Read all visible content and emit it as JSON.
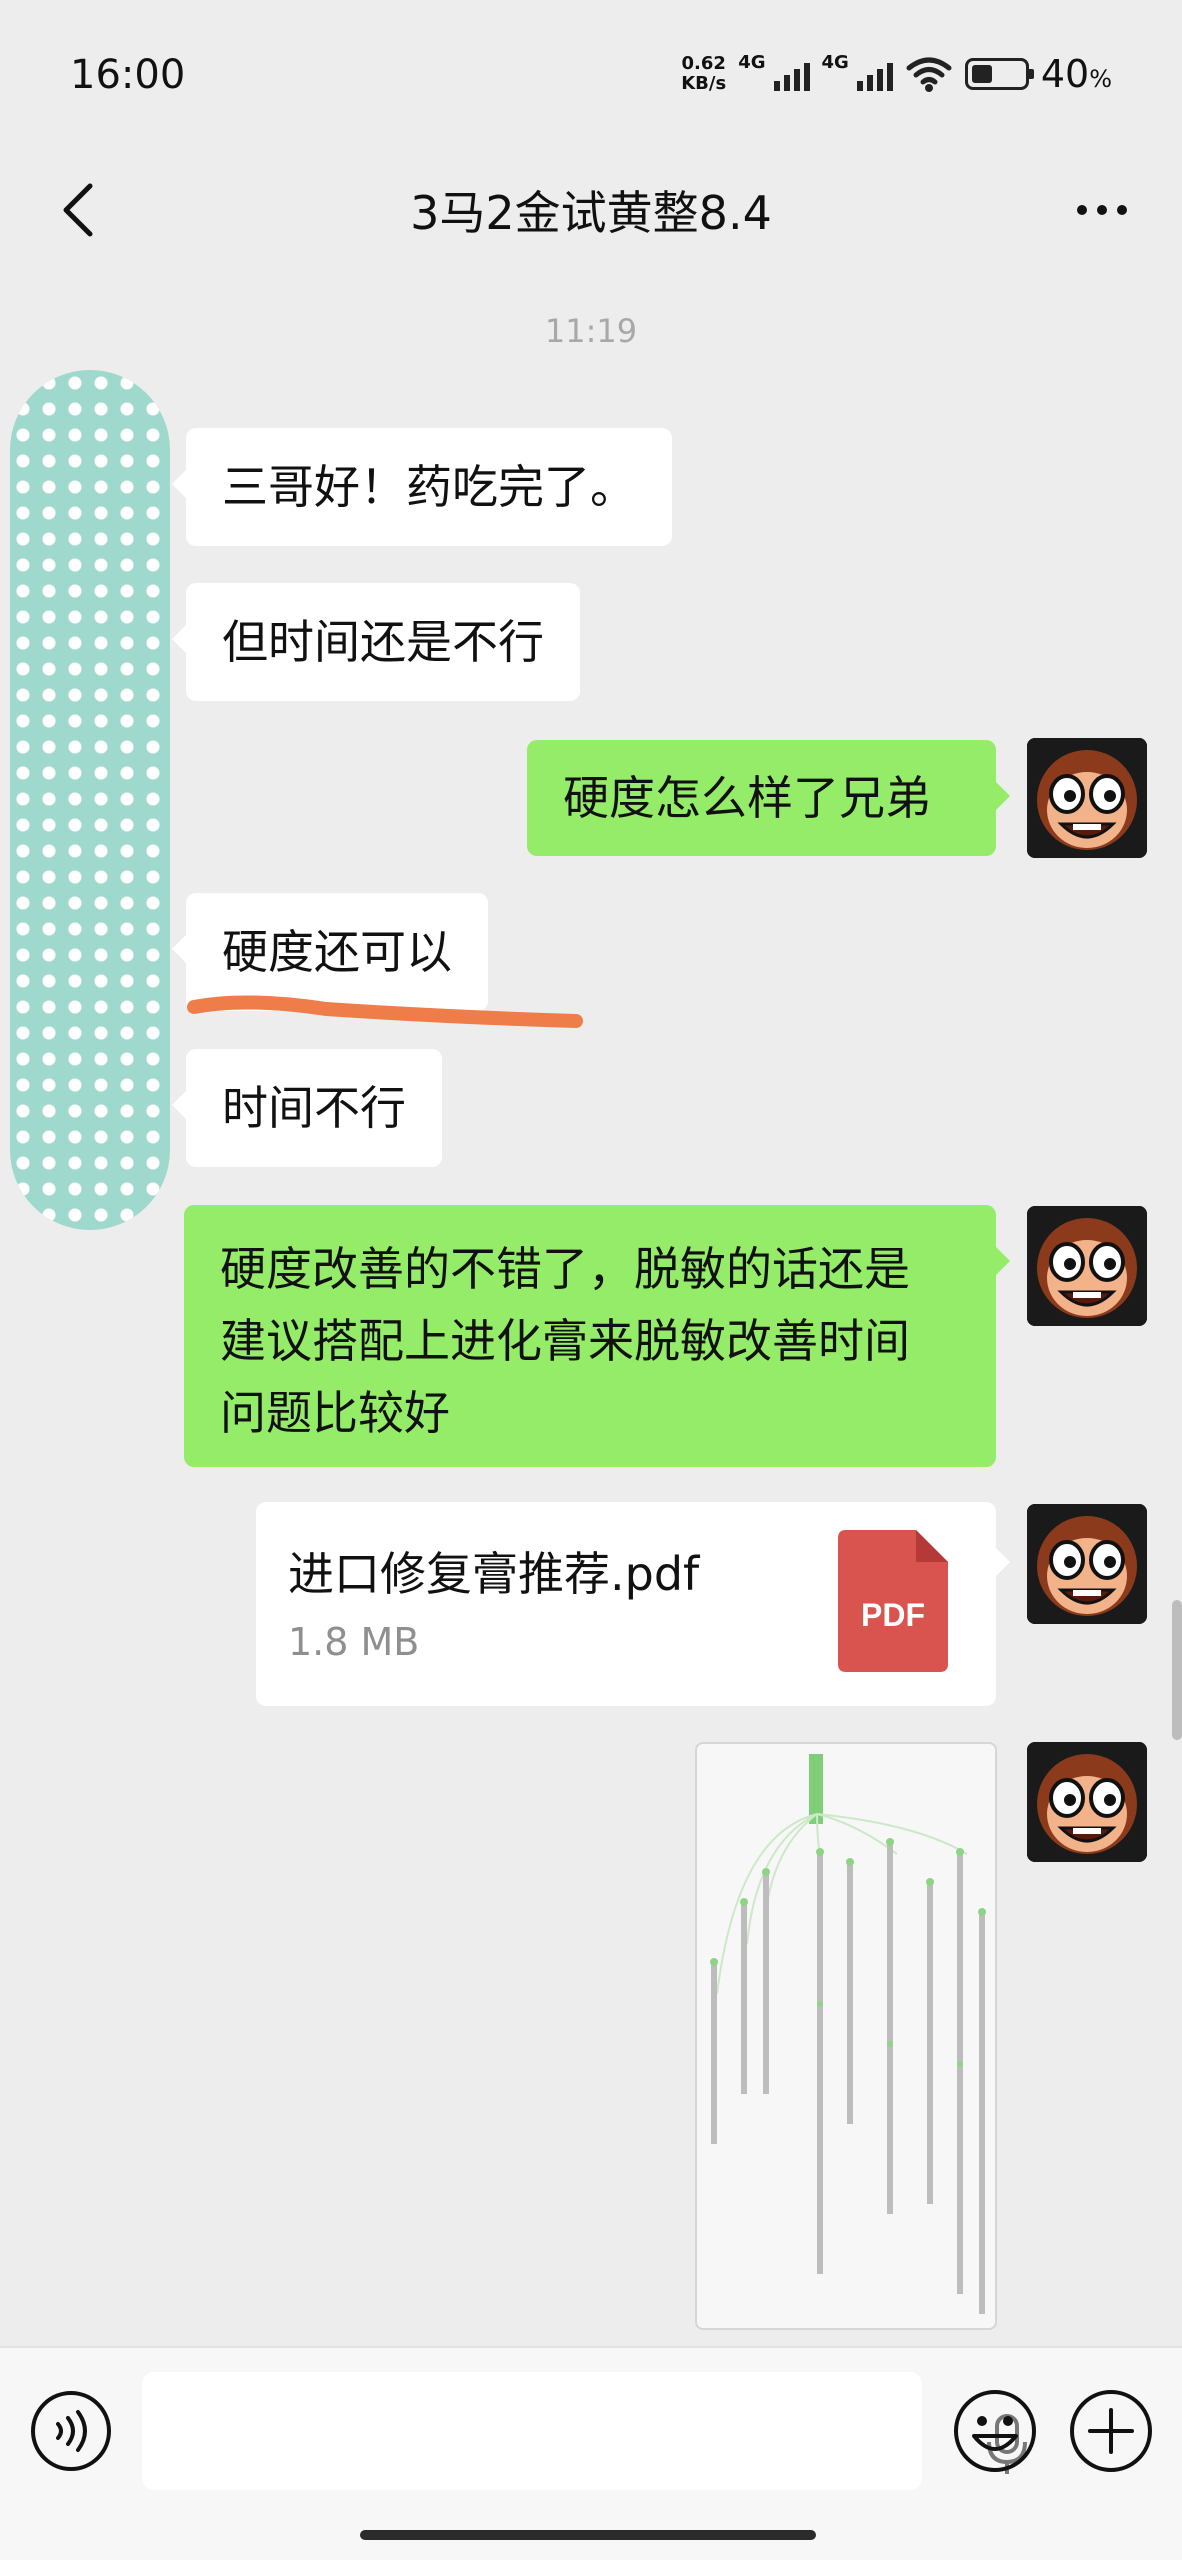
{
  "status_bar": {
    "time": "16:00",
    "net_speed_value": "0.62",
    "net_speed_unit": "KB/s",
    "signal_1_label": "4G",
    "signal_2_label": "4G",
    "battery_percent": "40",
    "battery_percent_sign": "%",
    "battery_level": 0.4
  },
  "header": {
    "title": "3马2金试黄整8.4"
  },
  "chat": {
    "timestamp": "11:19",
    "messages": [
      {
        "side": "in",
        "text": "三哥好！药吃完了。"
      },
      {
        "side": "in",
        "text": "但时间还是不行"
      },
      {
        "side": "out",
        "text": "硬度怎么样了兄弟"
      },
      {
        "side": "in",
        "text": "硬度还可以"
      },
      {
        "side": "in",
        "text": "时间不行"
      },
      {
        "side": "out",
        "lines": [
          "硬度改善的不错了，脱敏的话还是",
          "建议搭配上进化膏来脱敏改善时间",
          "问题比较好"
        ]
      }
    ],
    "file": {
      "name": "进口修复膏推荐.pdf",
      "size": "1.8 MB",
      "icon_label": "PDF",
      "icon_color": "#d9534f"
    },
    "image": {
      "icon": "mindmap-thumbnail"
    }
  },
  "input_bar": {
    "voice_icon": "voice-toggle-icon",
    "mic_icon": "microphone-icon",
    "emoji_icon": "emoji-icon",
    "plus_icon": "plus-icon"
  },
  "colors": {
    "background": "#ededed",
    "outgoing_bubble": "#95ec69",
    "incoming_bubble": "#ffffff",
    "highlight_underline": "#ee7d4a",
    "blob": "#9fd8cd"
  }
}
